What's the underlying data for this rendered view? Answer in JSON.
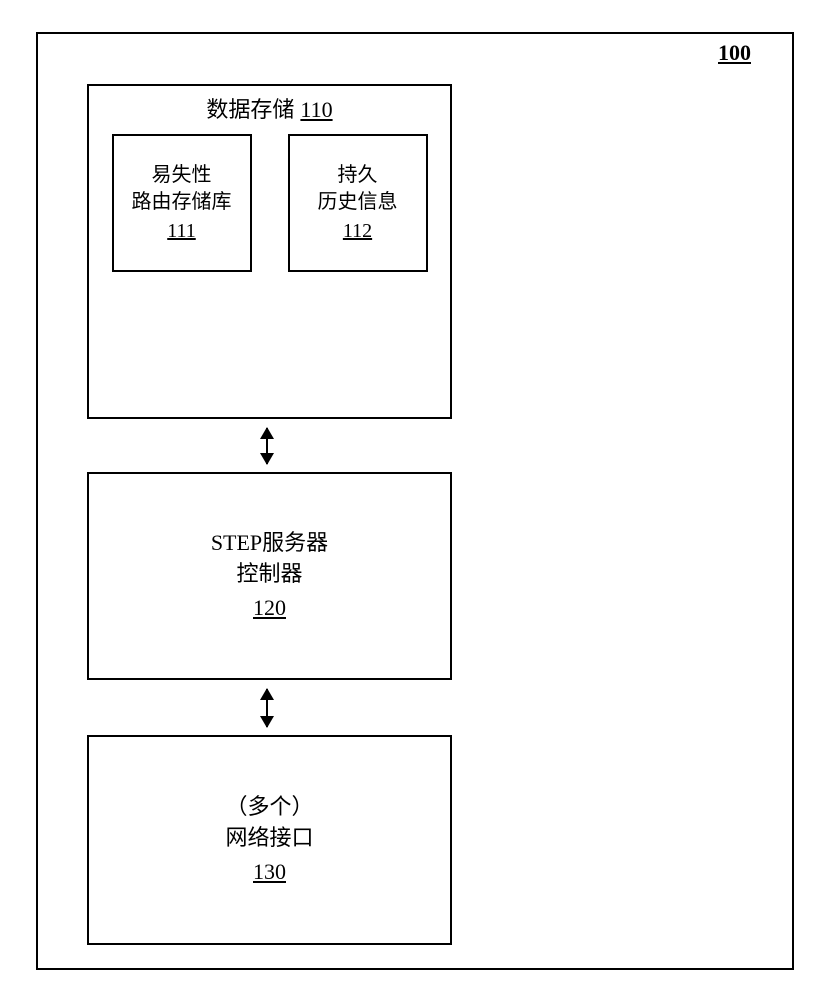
{
  "figure_label": "100",
  "box110": {
    "title": "数据存储",
    "number": "110",
    "sub111": {
      "line1": "易失性",
      "line2": "路由存储库",
      "number": "111"
    },
    "sub112": {
      "line1": "持久",
      "line2": "历史信息",
      "number": "112"
    }
  },
  "box120": {
    "line1": "STEP服务器",
    "line2": "控制器",
    "number": "120"
  },
  "box130": {
    "line1": "（多个）",
    "line2": "网络接口",
    "number": "130"
  }
}
